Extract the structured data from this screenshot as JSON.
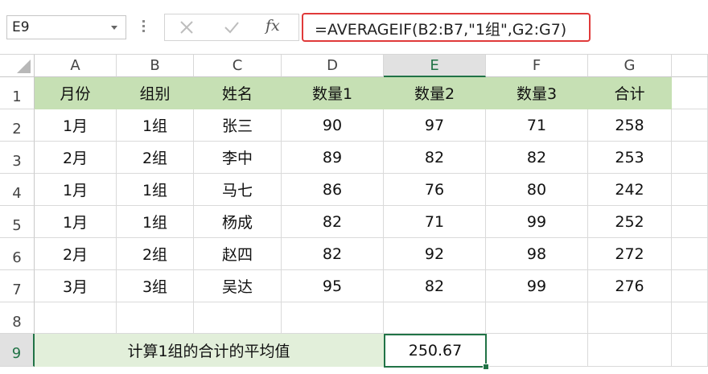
{
  "namebox": {
    "value": "E9"
  },
  "formula_bar": {
    "fx_label": "fx",
    "formula": "=AVERAGEIF(B2:B7,\"1组\",G2:G7)"
  },
  "sheet": {
    "columns": [
      "A",
      "B",
      "C",
      "D",
      "E",
      "F",
      "G"
    ],
    "rows": [
      "1",
      "2",
      "3",
      "4",
      "5",
      "6",
      "7",
      "8",
      "9"
    ],
    "header": [
      "月份",
      "组别",
      "姓名",
      "数量1",
      "数量2",
      "数量3",
      "合计"
    ],
    "data": [
      [
        "1月",
        "1组",
        "张三",
        "90",
        "97",
        "71",
        "258"
      ],
      [
        "2月",
        "2组",
        "李中",
        "89",
        "82",
        "82",
        "253"
      ],
      [
        "1月",
        "1组",
        "马七",
        "86",
        "76",
        "80",
        "242"
      ],
      [
        "1月",
        "1组",
        "杨成",
        "82",
        "71",
        "99",
        "252"
      ],
      [
        "2月",
        "2组",
        "赵四",
        "82",
        "92",
        "98",
        "272"
      ],
      [
        "3月",
        "3组",
        "吴达",
        "95",
        "82",
        "99",
        "276"
      ]
    ],
    "note": "计算1组的合计的平均值",
    "result": "250.67",
    "selected_column": "E",
    "selected_row": "9"
  },
  "colors": {
    "header_fill": "#c6e0b4",
    "note_fill": "#e2efda",
    "selection": "#217346",
    "formula_highlight": "#e03a3a"
  }
}
